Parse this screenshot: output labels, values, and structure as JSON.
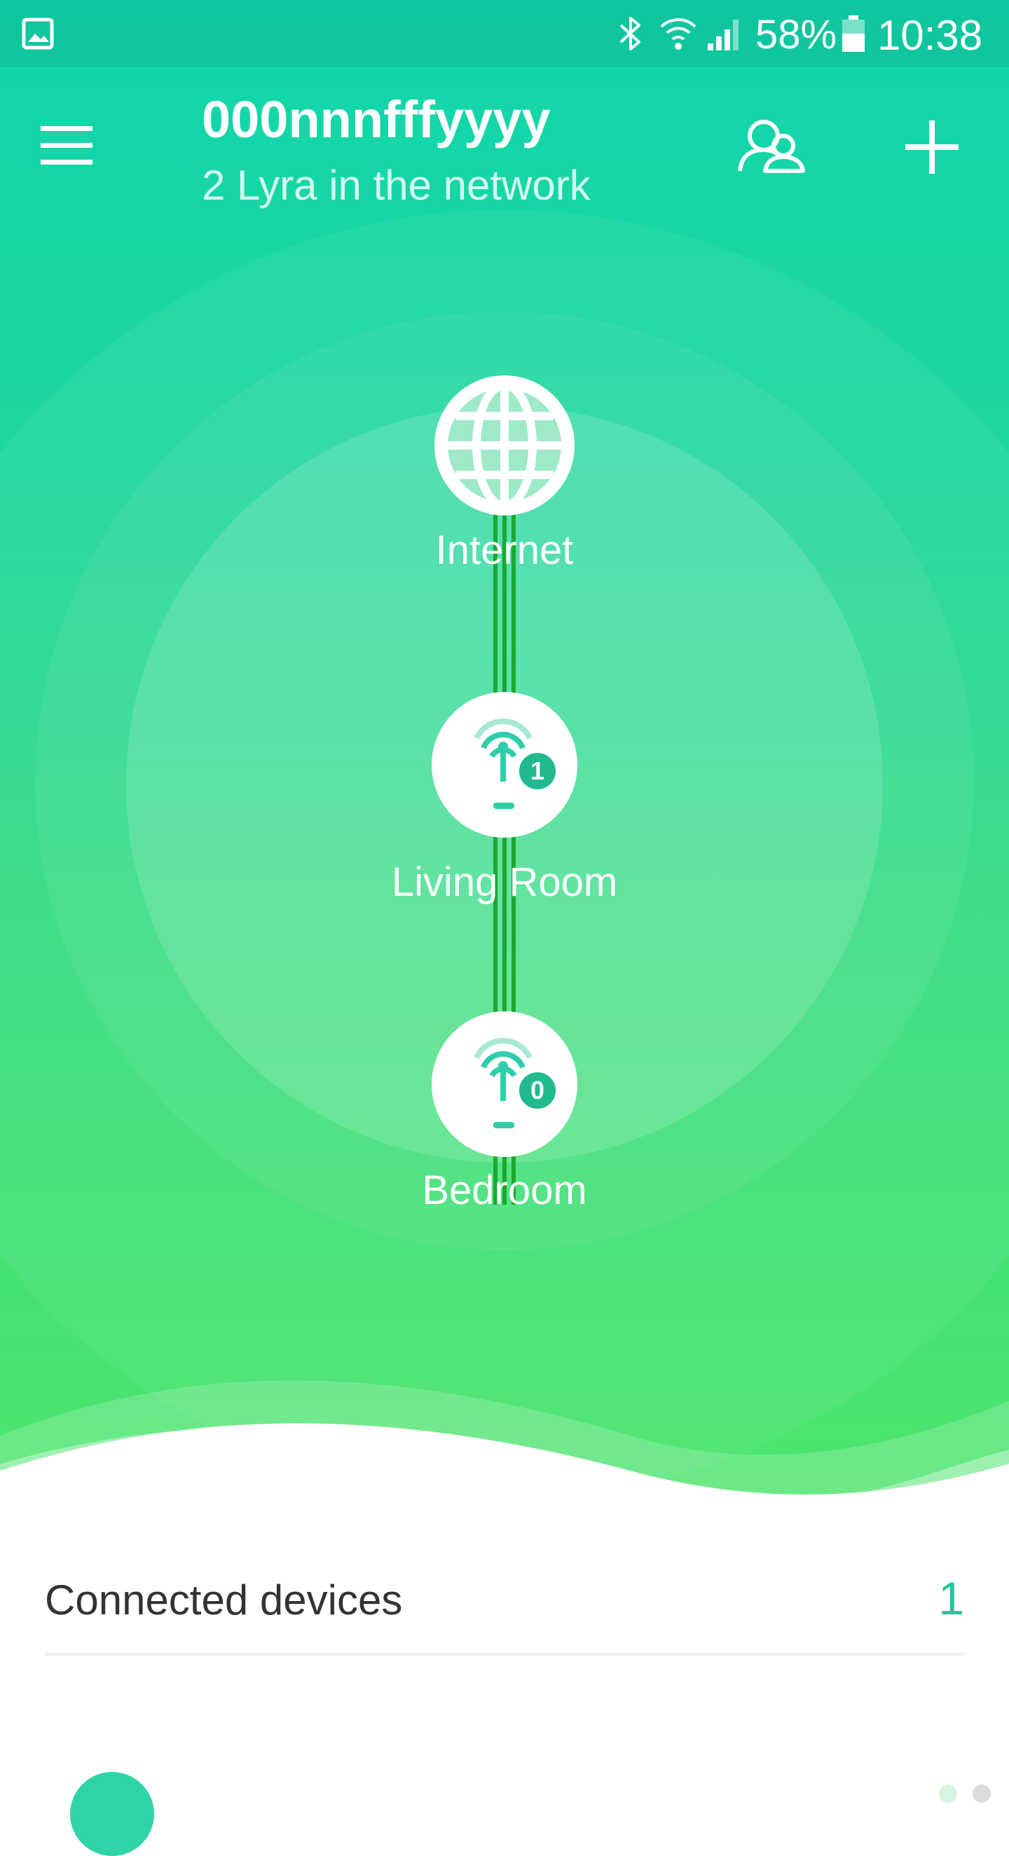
{
  "status_bar": {
    "battery": "58%",
    "time": "10:38",
    "icons": [
      "gallery-icon",
      "bluetooth-icon",
      "wifi-icon",
      "signal-icon",
      "battery-icon"
    ]
  },
  "app_bar": {
    "title": "000nnnfffyyyy",
    "subtitle": "2 Lyra in the network",
    "icons": [
      "menu-icon",
      "users-icon",
      "add-icon"
    ]
  },
  "network_map": {
    "nodes": [
      {
        "label": "Internet",
        "icon": "globe-icon"
      },
      {
        "label": "Living Room",
        "icon": "router-icon",
        "badge": "1"
      },
      {
        "label": "Bedroom",
        "icon": "router-icon",
        "badge": "0"
      }
    ]
  },
  "connected_devices": {
    "label": "Connected devices",
    "count": "1"
  },
  "page_indicator": {
    "pages": 2,
    "active": 0
  },
  "colors": {
    "accent": "#1dc79d",
    "gradient_top": "#10d6ad",
    "gradient_bottom": "#4ee56a",
    "link_line": "#1aa82f"
  }
}
